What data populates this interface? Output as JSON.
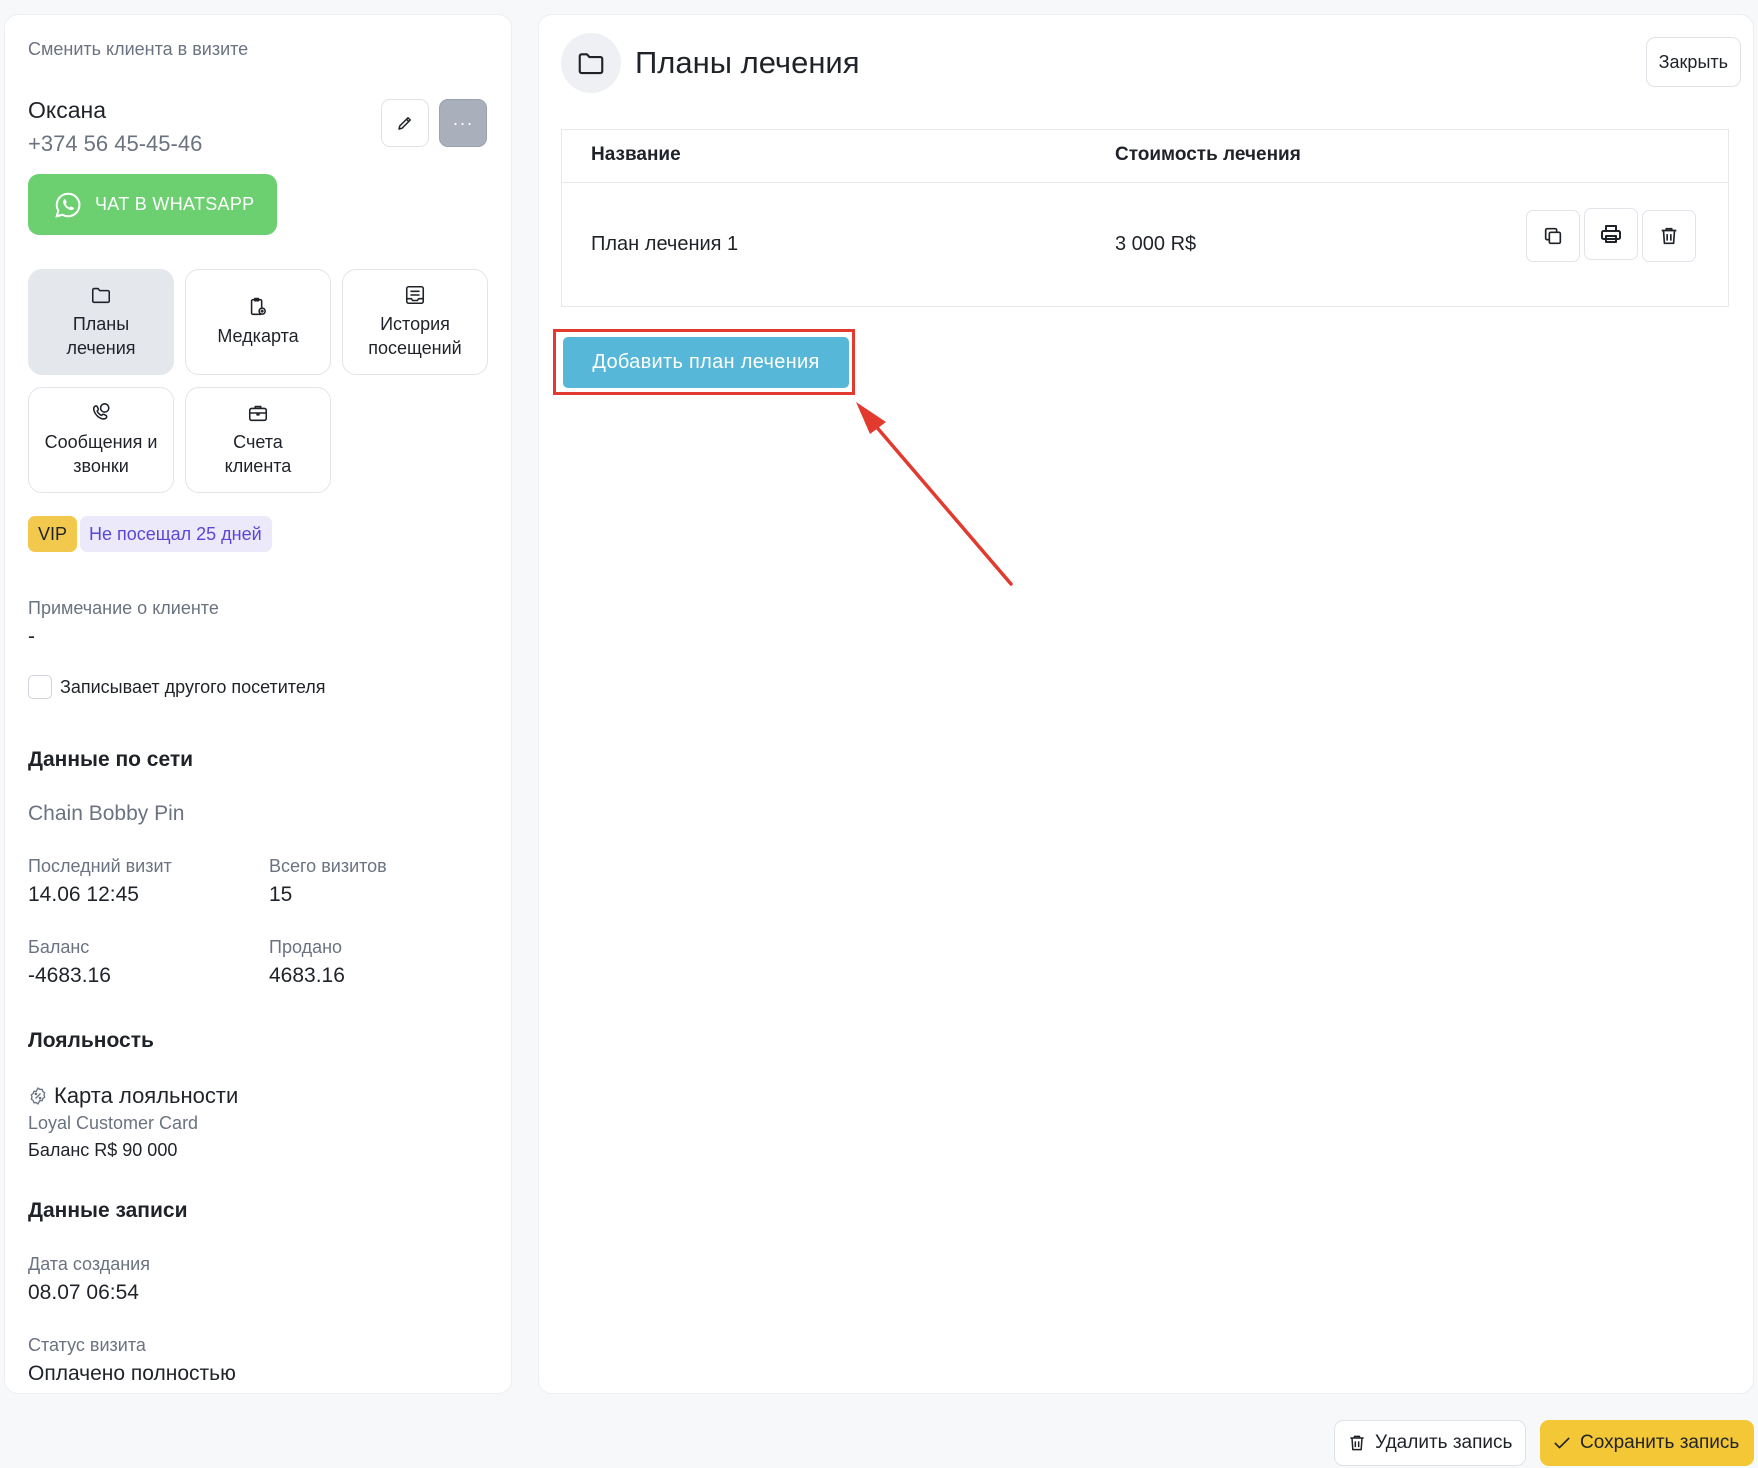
{
  "sidebar": {
    "change_client": "Сменить клиента в визите",
    "client_name": "Оксана",
    "client_phone": "+374 56 45-45-46",
    "more_label": "···",
    "whatsapp_label": "ЧАТ В WHATSAPP",
    "tiles": [
      {
        "label": "Планы лечения",
        "icon": "folder-icon",
        "active": true
      },
      {
        "label": "Медкарта",
        "icon": "medcard-icon",
        "active": false
      },
      {
        "label": "История посещений",
        "icon": "history-icon",
        "active": false
      },
      {
        "label": "Сообщения и звонки",
        "icon": "phone-chat-icon",
        "active": false
      },
      {
        "label": "Счета клиента",
        "icon": "briefcase-icon",
        "active": false
      }
    ],
    "badges": {
      "vip": "VIP",
      "visit": "Не посещал 25 дней"
    },
    "note_label": "Примечание о клиенте",
    "note_value": "-",
    "other_visitor_label": "Записывает другого посетителя",
    "network": {
      "title": "Данные по сети",
      "chain": "Chain Bobby Pin",
      "last_visit_label": "Последний визит",
      "last_visit": "14.06 12:45",
      "total_visits_label": "Всего визитов",
      "total_visits": "15",
      "balance_label": "Баланс",
      "balance": "-4683.16",
      "sold_label": "Продано",
      "sold": "4683.16"
    },
    "loyalty": {
      "title": "Лояльность",
      "card_title": "Карта лояльности",
      "card_name": "Loyal Customer Card",
      "card_balance": "Баланс R$ 90 000"
    },
    "record": {
      "title": "Данные записи",
      "created_label": "Дата создания",
      "created": "08.07 06:54",
      "status_label": "Статус визита",
      "status": "Оплачено полностью"
    }
  },
  "main": {
    "title": "Планы лечения",
    "close_label": "Закрыть",
    "columns": [
      "Название",
      "Стоимость лечения"
    ],
    "rows": [
      {
        "name": "План лечения 1",
        "cost": "3 000 R$"
      }
    ],
    "add_label": "Добавить план лечения"
  },
  "footer": {
    "delete_label": "Удалить запись",
    "save_label": "Сохранить запись"
  },
  "colors": {
    "whatsapp": "#6cd071",
    "add_button": "#56b7d9",
    "save_button": "#f4c737",
    "highlight": "#e23a2f",
    "vip": "#f2c94c"
  }
}
